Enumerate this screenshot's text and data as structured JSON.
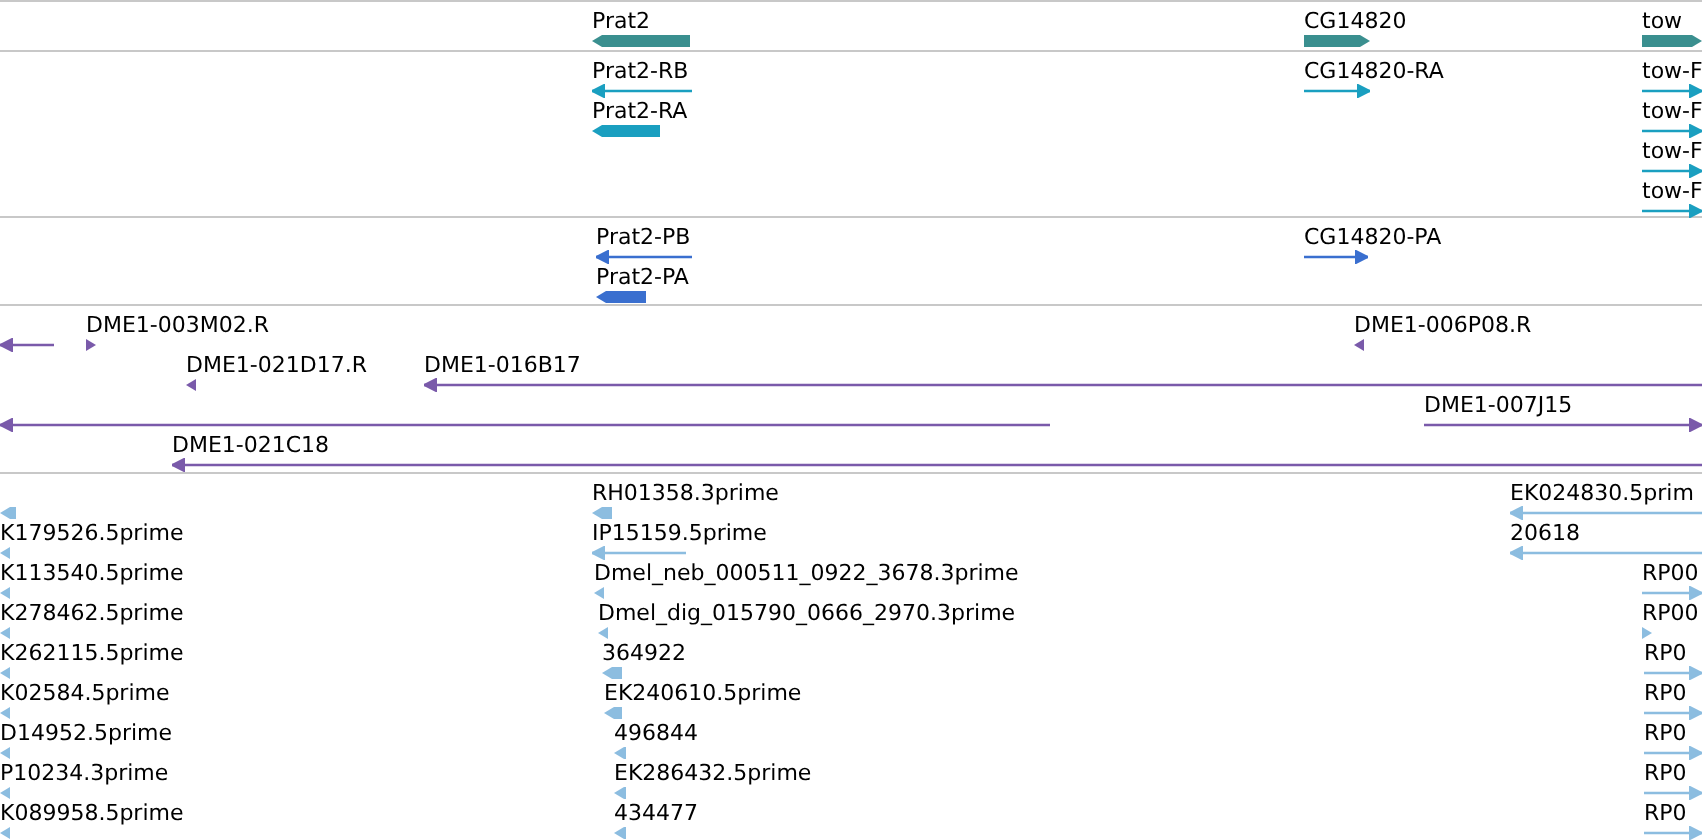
{
  "tracks": [
    {
      "color": "#3a8f8f",
      "features": [
        {
          "label": "Prat2",
          "reverse": true
        },
        {
          "label": "CG14820",
          "reverse": false
        },
        {
          "label": "tow",
          "reverse": false
        }
      ]
    },
    {
      "color": "#1a9fc0",
      "features": [
        {
          "label": "Prat2-RB",
          "reverse": true
        },
        {
          "label": "Prat2-RA",
          "reverse": true
        },
        {
          "label": "CG14820-RA",
          "reverse": false
        },
        {
          "label": "tow-F",
          "reverse": false
        },
        {
          "label": "tow-F",
          "reverse": false
        },
        {
          "label": "tow-F",
          "reverse": false
        },
        {
          "label": "tow-F",
          "reverse": false
        }
      ]
    },
    {
      "color": "#3a6fcf",
      "features": [
        {
          "label": "Prat2-PB",
          "reverse": true
        },
        {
          "label": "Prat2-PA",
          "reverse": true
        },
        {
          "label": "CG14820-PA",
          "reverse": false
        }
      ]
    },
    {
      "color": "#7a5aaa",
      "features": [
        {
          "reverse": true
        },
        {
          "label": "DME1-003M02.R",
          "reverse": false
        },
        {
          "label": "DME1-006P08.R",
          "reverse": true
        },
        {
          "label": "DME1-021D17.R",
          "reverse": true
        },
        {
          "label": "DME1-016B17",
          "reverse": true
        },
        {
          "reverse": true
        },
        {
          "label": "DME1-007J15",
          "reverse": false
        },
        {
          "label": "DME1-021C18",
          "reverse": true
        }
      ]
    },
    {
      "color": "#8cbde0",
      "features": [
        {
          "reverse": true
        },
        {
          "label": "K179526.5prime",
          "reverse": true
        },
        {
          "label": "K113540.5prime",
          "reverse": true
        },
        {
          "label": "K278462.5prime",
          "reverse": true
        },
        {
          "label": "K262115.5prime",
          "reverse": true
        },
        {
          "label": "K02584.5prime",
          "reverse": true
        },
        {
          "label": "D14952.5prime",
          "reverse": true
        },
        {
          "label": "P10234.3prime",
          "reverse": true
        },
        {
          "label": "K089958.5prime",
          "reverse": true
        },
        {
          "label": "RH01358.3prime",
          "reverse": true
        },
        {
          "label": "IP15159.5prime",
          "reverse": true
        },
        {
          "label": "Dmel_neb_000511_0922_3678.3prime",
          "reverse": true
        },
        {
          "label": "Dmel_dig_015790_0666_2970.3prime",
          "reverse": true
        },
        {
          "label": "364922",
          "reverse": true
        },
        {
          "label": "EK240610.5prime",
          "reverse": true
        },
        {
          "label": "496844",
          "reverse": true
        },
        {
          "label": "EK286432.5prime",
          "reverse": true
        },
        {
          "label": "434477",
          "reverse": true
        },
        {
          "label": "EK024830.5prim",
          "reverse": true
        },
        {
          "label": "20618",
          "reverse": true
        },
        {
          "label": "RP00",
          "reverse": false
        },
        {
          "label": "RP00",
          "reverse": false
        },
        {
          "label": "RP0",
          "reverse": false
        },
        {
          "label": "RP0",
          "reverse": false
        },
        {
          "label": "RP0",
          "reverse": false
        },
        {
          "label": "RP0",
          "reverse": false
        },
        {
          "label": "RP0",
          "reverse": false
        }
      ]
    }
  ]
}
